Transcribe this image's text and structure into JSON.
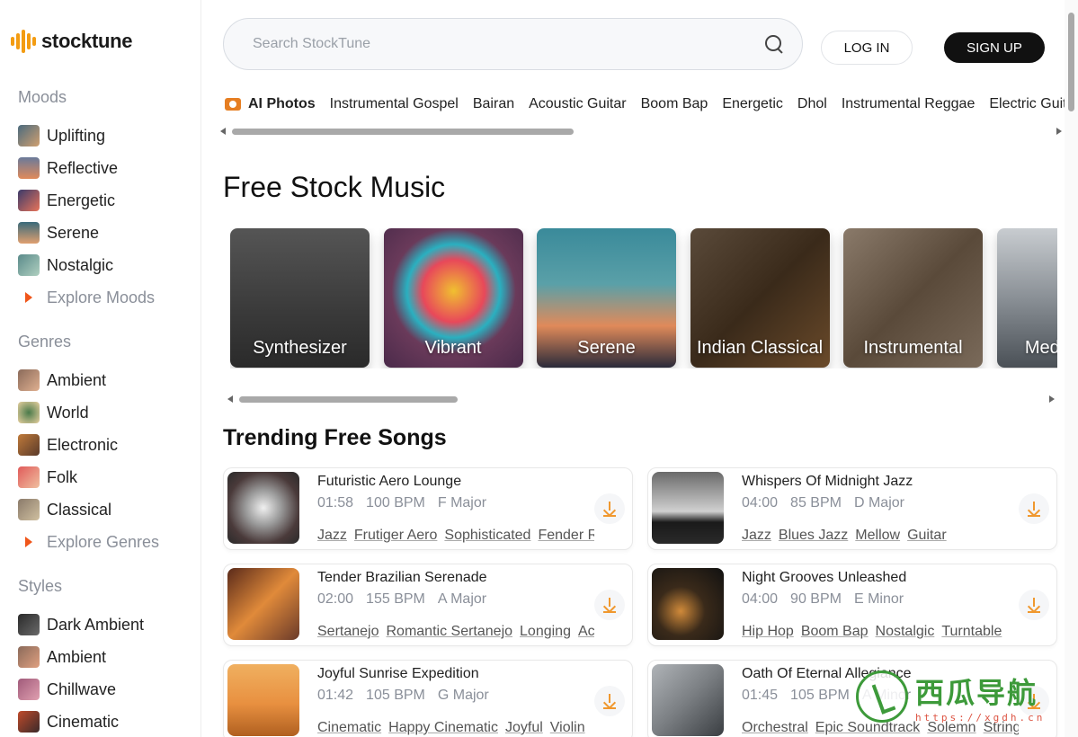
{
  "brand": {
    "name": "stocktune",
    "accent": "#f39c12"
  },
  "sidebar": {
    "moods": {
      "heading": "Moods",
      "items": [
        {
          "label": "Uplifting",
          "thumb": "linear-gradient(135deg,#4a6a7e,#d0a070)"
        },
        {
          "label": "Reflective",
          "thumb": "linear-gradient(180deg,#6a7a9a,#e08a5a)"
        },
        {
          "label": "Energetic",
          "thumb": "linear-gradient(135deg,#3a3a6a,#e8745a)"
        },
        {
          "label": "Serene",
          "thumb": "linear-gradient(180deg,#3a6a7a,#e0a070)"
        },
        {
          "label": "Nostalgic",
          "thumb": "linear-gradient(135deg,#5a8a8a,#b0d0c0)"
        }
      ],
      "explore": "Explore Moods"
    },
    "genres": {
      "heading": "Genres",
      "items": [
        {
          "label": "Ambient",
          "thumb": "linear-gradient(135deg,#8a6a5a,#e0b090)"
        },
        {
          "label": "World",
          "thumb": "radial-gradient(circle,#4a7a4a,#e8d0a0)"
        },
        {
          "label": "Electronic",
          "thumb": "linear-gradient(135deg,#c07a3a,#5a3a2a)"
        },
        {
          "label": "Folk",
          "thumb": "linear-gradient(135deg,#e05a5a,#f0c0a0)"
        },
        {
          "label": "Classical",
          "thumb": "linear-gradient(135deg,#8a7a6a,#d0c0a0)"
        }
      ],
      "explore": "Explore Genres"
    },
    "styles": {
      "heading": "Styles",
      "items": [
        {
          "label": "Dark Ambient",
          "thumb": "linear-gradient(135deg,#2a2a2a,#6a6a6a)"
        },
        {
          "label": "Ambient",
          "thumb": "linear-gradient(135deg,#8a6a5a,#e0a080)"
        },
        {
          "label": "Chillwave",
          "thumb": "linear-gradient(135deg,#a05a7a,#e0a0b0)"
        },
        {
          "label": "Cinematic",
          "thumb": "linear-gradient(135deg,#c04a2a,#3a2a2a)"
        }
      ]
    }
  },
  "header": {
    "search_placeholder": "Search StockTune",
    "login": "LOG IN",
    "signup": "SIGN UP"
  },
  "tags": [
    "AI Photos",
    "Instrumental Gospel",
    "Bairan",
    "Acoustic Guitar",
    "Boom Bap",
    "Energetic",
    "Dhol",
    "Instrumental Reggae",
    "Electric Guitar"
  ],
  "free_stock": {
    "heading": "Free Stock Music",
    "cards": [
      {
        "label": "Synthesizer",
        "bg": "linear-gradient(180deg,#555 0%,#3a3a3a 60%,#2a2a2a 100%)"
      },
      {
        "label": "Vibrant",
        "bg": "radial-gradient(circle at 50% 45%,#f0c030 0%,#e8485a 30%,#2ab0c0 45%,#6a3a5a 60%,#4a2a4a 100%)"
      },
      {
        "label": "Serene",
        "bg": "linear-gradient(180deg,#3a8a9a 0%,#5aa0a8 40%,#e08a5a 70%,#2a2a3a 100%)"
      },
      {
        "label": "Indian Classical",
        "bg": "linear-gradient(135deg,#5a4a3a 0%,#3a2a1a 50%,#6a4a2a 100%)"
      },
      {
        "label": "Instrumental",
        "bg": "linear-gradient(135deg,#8a7a6a 0%,#5a4a3a 50%,#7a6a5a 100%)"
      },
      {
        "label": "Meditation",
        "bg": "linear-gradient(180deg,#c8ccd0 0%,#8a9096 50%,#4a5056 100%)"
      }
    ]
  },
  "trending": {
    "heading": "Trending Free Songs",
    "songs": [
      {
        "title": "Futuristic Aero Lounge",
        "duration": "01:58",
        "bpm": "100 BPM",
        "key": "F Major",
        "tags": [
          "Jazz",
          "Frutiger Aero",
          "Sophisticated",
          "Fender Rhodes"
        ],
        "art": "radial-gradient(circle at 50% 50%,#f0f0f0 0%,#9a9a9a 35%,#4a3a3a 70%,#2a2a2a 100%)"
      },
      {
        "title": "Whispers Of Midnight Jazz",
        "duration": "04:00",
        "bpm": "85 BPM",
        "key": "D Major",
        "tags": [
          "Jazz",
          "Blues Jazz",
          "Mellow",
          "Guitar"
        ],
        "art": "linear-gradient(180deg,#6a6a6a 0%,#d0d0d0 55%,#1a1a1a 70%,#2a2a2a 100%)"
      },
      {
        "title": "Tender Brazilian Serenade",
        "duration": "02:00",
        "bpm": "155 BPM",
        "key": "A Major",
        "tags": [
          "Sertanejo",
          "Romantic Sertanejo",
          "Longing",
          "Acoustic"
        ],
        "art": "linear-gradient(135deg,#5a2a1a 0%,#e08a3a 50%,#6a3a2a 100%)"
      },
      {
        "title": "Night Grooves Unleashed",
        "duration": "04:00",
        "bpm": "90 BPM",
        "key": "E Minor",
        "tags": [
          "Hip Hop",
          "Boom Bap",
          "Nostalgic",
          "Turntable"
        ],
        "art": "radial-gradient(circle at 40% 60%,#d08a3a 0%,#3a2a1a 40%,#111 100%)"
      },
      {
        "title": "Joyful Sunrise Expedition",
        "duration": "01:42",
        "bpm": "105 BPM",
        "key": "G Major",
        "tags": [
          "Cinematic",
          "Happy Cinematic",
          "Joyful",
          "Violin"
        ],
        "art": "linear-gradient(180deg,#f0b060 0%,#e89040 55%,#b06020 100%)"
      },
      {
        "title": "Oath Of Eternal Allegiance",
        "duration": "01:45",
        "bpm": "105 BPM",
        "key": "A Minor",
        "tags": [
          "Orchestral",
          "Epic Soundtrack",
          "Solemn",
          "String"
        ],
        "art": "linear-gradient(135deg,#b0b4b8 0%,#7a7e82 50%,#3a3e42 100%)"
      }
    ]
  },
  "watermark": {
    "cn": "西瓜导航",
    "url": "https://xgdh.cn"
  }
}
